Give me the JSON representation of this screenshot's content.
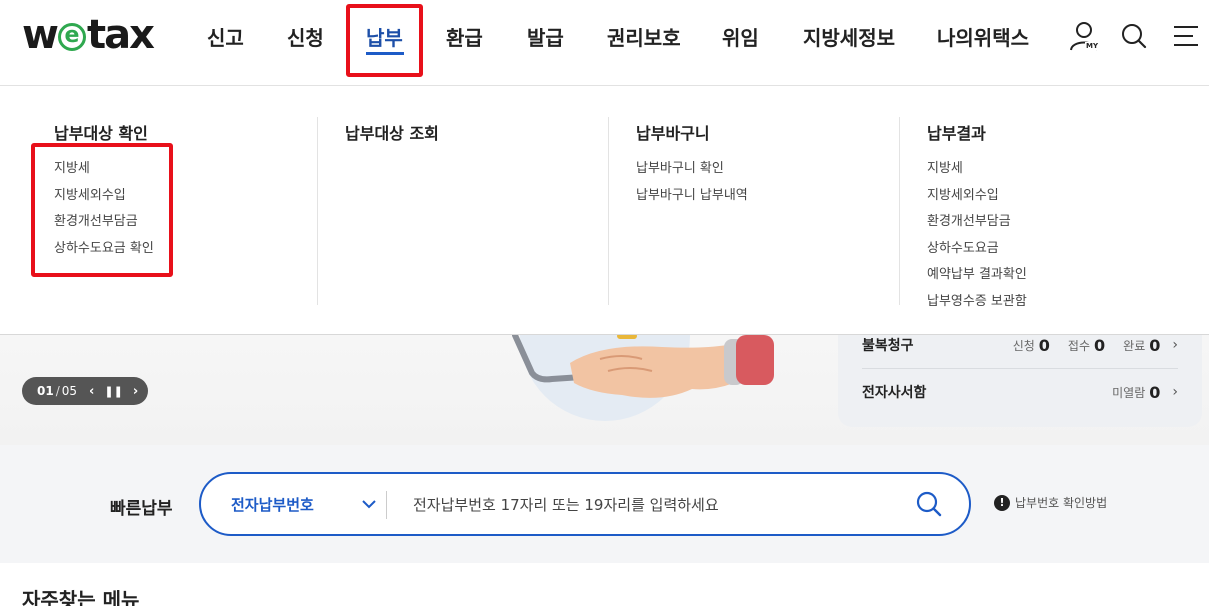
{
  "logo": {
    "pre": "w",
    "mid": "e",
    "post": "tax"
  },
  "nav": [
    {
      "label": "신고",
      "active": false
    },
    {
      "label": "신청",
      "active": false
    },
    {
      "label": "납부",
      "active": true
    },
    {
      "label": "환급",
      "active": false
    },
    {
      "label": "발급",
      "active": false
    },
    {
      "label": "권리보호",
      "active": false
    },
    {
      "label": "위임",
      "active": false
    },
    {
      "label": "지방세정보",
      "active": false
    },
    {
      "label": "나의위택스",
      "active": false
    }
  ],
  "util": {
    "my_label": "MY",
    "icons": [
      "user-icon",
      "search-icon",
      "menu-icon"
    ]
  },
  "mega": {
    "columns": [
      {
        "title": "납부대상 확인",
        "links": [
          "지방세",
          "지방세외수입",
          "환경개선부담금",
          "상하수도요금 확인"
        ]
      },
      {
        "title": "납부대상 조회",
        "links": []
      },
      {
        "title": "납부바구니",
        "links": [
          "납부바구니 확인",
          "납부바구니 납부내역"
        ]
      },
      {
        "title": "납부결과",
        "links": [
          "지방세",
          "지방세외수입",
          "환경개선부담금",
          "상하수도요금",
          "예약납부 결과확인",
          "납부영수증 보관함"
        ]
      }
    ]
  },
  "hero": {
    "pager_current": "01",
    "pager_sep": "/",
    "pager_total": "05"
  },
  "status": {
    "rows": [
      {
        "label": "불복청구",
        "items": [
          {
            "k": "신청",
            "v": "0"
          },
          {
            "k": "접수",
            "v": "0"
          },
          {
            "k": "완료",
            "v": "0"
          }
        ]
      },
      {
        "label": "전자사서함",
        "items": [
          {
            "k": "미열람",
            "v": "0"
          }
        ]
      }
    ]
  },
  "quick": {
    "label": "빠른납부",
    "select": "전자납부번호",
    "placeholder": "전자납부번호 17자리 또는 19자리를 입력하세요",
    "help": "납부번호 확인방법"
  },
  "favorites": {
    "title": "자주찾는 메뉴"
  },
  "colors": {
    "accent": "#1d5bc7",
    "highlight": "#e8101a",
    "logo_e": "#2fa84f"
  }
}
